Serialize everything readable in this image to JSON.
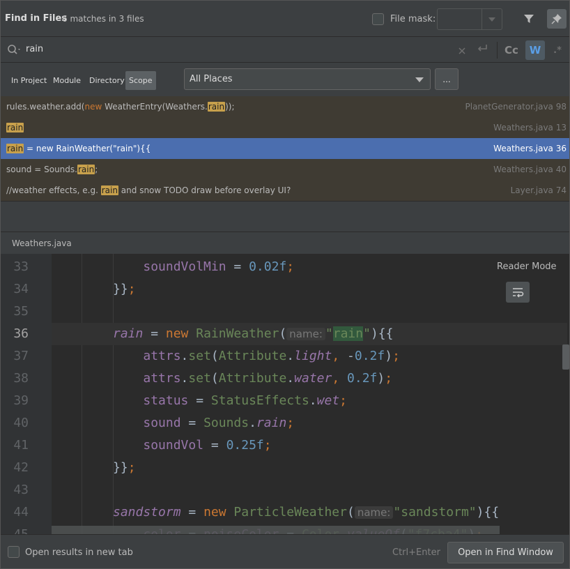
{
  "header": {
    "title": "Find in Files",
    "subtitle": "6 matches in 3 files",
    "file_mask_label": "File mask:",
    "file_mask_value": ""
  },
  "search": {
    "query": "rain"
  },
  "options": {
    "case_label": "Cc",
    "word_label": "W",
    "regex_label": ".*"
  },
  "scope": {
    "tabs": [
      {
        "label": "In Project",
        "active": false
      },
      {
        "label": "Module",
        "active": false
      },
      {
        "label": "Directory",
        "active": false
      },
      {
        "label": "Scope",
        "active": true
      }
    ],
    "selected": "All Places",
    "browse_label": "..."
  },
  "results": [
    {
      "pre": "rules.weather.add(",
      "kw": "new",
      "mid": " WeatherEntry(Weathers.",
      "match": "rain",
      "post": "));",
      "file": "PlanetGenerator.java 98"
    },
    {
      "pre": "",
      "kw": "",
      "mid": "",
      "match": "rain",
      "post": "",
      "file": "Weathers.java 13"
    },
    {
      "pre": "",
      "kw": "",
      "mid": "",
      "match": "rain",
      "post": " = new RainWeather(\"rain\"){{",
      "file": "Weathers.java 36",
      "selected": true
    },
    {
      "pre": "sound = Sounds.",
      "kw": "",
      "mid": "",
      "match": "rain",
      "post": ";",
      "file": "Weathers.java 40"
    },
    {
      "pre": "//weather effects, e.g. ",
      "kw": "",
      "mid": "",
      "match": "rain",
      "post": " and snow TODO draw before overlay UI?",
      "file": "Layer.java 74"
    }
  ],
  "editor": {
    "file_name": "Weathers.java",
    "reader_mode": "Reader Mode",
    "line_numbers": [
      "33",
      "34",
      "35",
      "36",
      "37",
      "38",
      "39",
      "40",
      "41",
      "42",
      "43",
      "44",
      "45"
    ],
    "hint_name": "name:"
  },
  "footer": {
    "open_new_tab_label": "Open results in new tab",
    "shortcut": "Ctrl+Enter",
    "open_button": "Open in Find Window"
  }
}
